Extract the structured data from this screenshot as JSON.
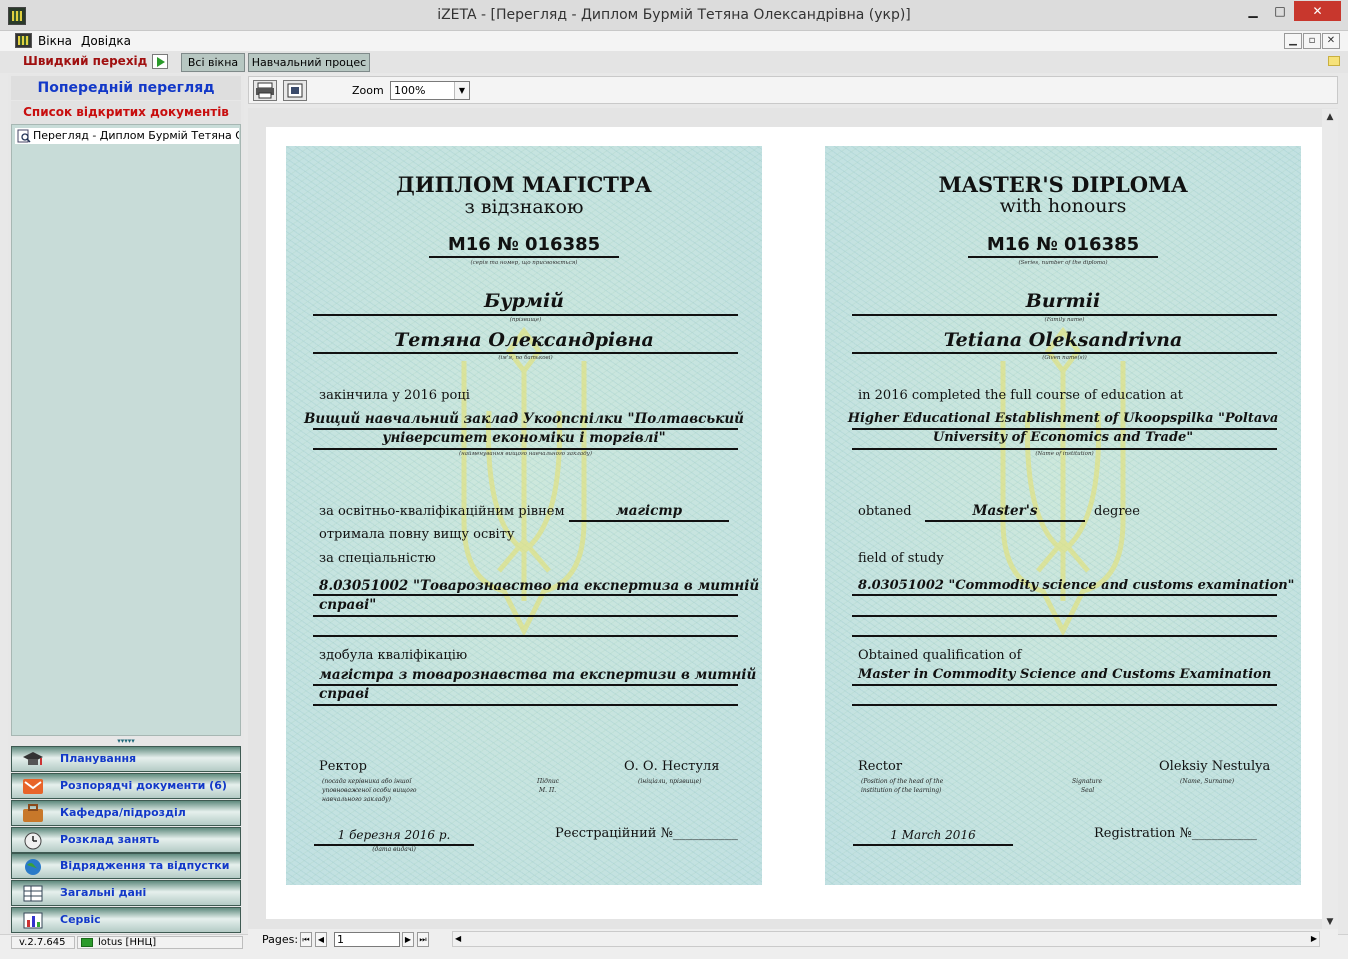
{
  "window": {
    "title": "iZETA - [Перегляд - Диплом Бурмій Тетяна Олександрівна (укр)]",
    "btn_minimize": "▁",
    "btn_maximize": "□",
    "btn_close": "✕"
  },
  "menu": {
    "items": [
      "Вікна",
      "Довідка"
    ],
    "mdi": [
      "▁",
      "▫",
      "✕"
    ]
  },
  "quickbar": {
    "label": "Швидкий перехід",
    "tabs": [
      "Всі вікна",
      "Навчальний процес"
    ]
  },
  "sidebar": {
    "header": "Попередній перегляд",
    "list_title": "Список відкритих документів",
    "documents": [
      "Перегляд - Диплом Бурмій Тетяна Ол..."
    ],
    "splitter": "▾▾▾▾▾",
    "nav": [
      {
        "label": "Планування",
        "icon": "graduation-icon"
      },
      {
        "label": "Розпорядчі документи (6)",
        "icon": "mail-icon"
      },
      {
        "label": "Кафедра/підрозділ",
        "icon": "briefcase-icon"
      },
      {
        "label": "Розклад занять",
        "icon": "clock-icon"
      },
      {
        "label": "Відрядження та відпустки",
        "icon": "globe-icon"
      },
      {
        "label": "Загальні дані",
        "icon": "table-icon"
      },
      {
        "label": "Сервіс",
        "icon": "chart-icon"
      }
    ]
  },
  "status": {
    "version": "v.2.7.645",
    "server": "lotus [ННЦ]"
  },
  "toolbar": {
    "zoom_label": "Zoom",
    "zoom_value": "100%"
  },
  "pager": {
    "label": "Pages:",
    "current": "1",
    "first": "⏮",
    "prev": "◀",
    "next": "▶",
    "last": "⏭"
  },
  "diploma_ua": {
    "title": "ДИПЛОМ МАГІСТРА",
    "subtitle": "з відзнакою",
    "number": "М16  №  016385",
    "cap_number": "(серія та номер, що присвоюється)",
    "surname": "Бурмій",
    "cap_surname": "(прізвище)",
    "given": "Тетяна Олександрівна",
    "cap_given": "(ім'я, по батькові)",
    "completed": "закінчила у 2016 році",
    "institution_1": "Вищий навчальний заклад Укоопспілки \"Полтавський",
    "institution_2": "університет економіки і торгівлі\"",
    "cap_institution": "(найменування вищого навчального закладу)",
    "level_text": "за освітньо-кваліфікаційним рівнем",
    "level": "магістр",
    "full_edu": "отримала повну вищу освіту",
    "specialty_label": "за спеціальністю",
    "specialty_1": "8.03051002 \"Товарознавство та експертиза в митній",
    "specialty_2": "справі\"",
    "qual_label": "здобула кваліфікацію",
    "qual_1": "магістра з товарознавства та експертизи в митній",
    "qual_2": "справі",
    "rector": "Ректор",
    "rector_name": "О. О. Нестуля",
    "cap_rector_1": "(посада керівника або іншої",
    "cap_rector_2": "уповноваженої особи вищого",
    "cap_rector_3": "навчального закладу)",
    "cap_sign_1": "Підпис",
    "cap_sign_2": "М. П.",
    "cap_name": "(ініціали, прізвище)",
    "date": "1 березня 2016 р.",
    "cap_date": "(дата видачі)",
    "registration": "Реєстраційний №__________"
  },
  "diploma_en": {
    "title": "MASTER'S DIPLOMA",
    "subtitle": "with honours",
    "number": "М16  №  016385",
    "cap_number": "(Series, number of the diploma)",
    "surname": "Burmii",
    "cap_surname": "(Family name)",
    "given": "Tetiana Oleksandrivna",
    "cap_given": "(Given name(s))",
    "completed": "in 2016 completed the full course of education at",
    "institution_1": "Higher Educational Establishment of Ukoopspilka \"Poltava",
    "institution_2": "University of Economics and Trade\"",
    "cap_institution": "(Name of institution)",
    "obtained": "obtaned",
    "level": "Master's",
    "degree": "degree",
    "field_label": "field of study",
    "specialty_1": "8.03051002 \"Commodity science and customs examination\"",
    "qual_label": "Obtained qualification of",
    "qual_1": "Master in Commodity Science and Customs Examination",
    "rector": "Rector",
    "rector_name": "Oleksiy Nestulya",
    "cap_rector_1": "(Position of the head of the",
    "cap_rector_2": "institution of the learning)",
    "cap_sign_1": "Signature",
    "cap_sign_2": "Seal",
    "cap_name": "(Name, Surname)",
    "date": "1 March 2016",
    "registration": "Registration №__________"
  }
}
